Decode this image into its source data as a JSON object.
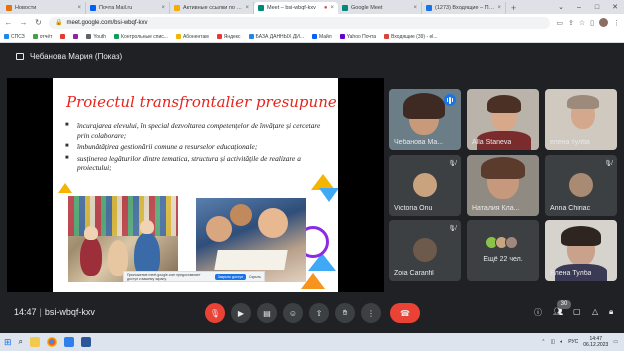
{
  "browser": {
    "tabs": [
      {
        "title": "Новости",
        "color": "#e8710a",
        "active": false
      },
      {
        "title": "Почта Mail.ru",
        "color": "#005ff9",
        "active": false
      },
      {
        "title": "Активные ссылки по сез...",
        "color": "#f9ab00",
        "active": false
      },
      {
        "title": "Meet – bsi-wbqf-kxv",
        "color": "#00897b",
        "active": true
      },
      {
        "title": "Google Meet",
        "color": "#00897b",
        "active": false
      },
      {
        "title": "(1273) Входящие – Почта",
        "color": "#1a73e8",
        "active": false
      }
    ],
    "new_tab": "+",
    "url": "meet.google.com/bsi-wbqf-kxv",
    "bookmarks": [
      {
        "label": "СПСЗ",
        "color": "#1e88e5"
      },
      {
        "label": "отчёт",
        "color": "#43a047"
      },
      {
        "label": "",
        "color": "#e53935"
      },
      {
        "label": "",
        "color": "#8e24aa"
      },
      {
        "label": "Youth",
        "color": "#5f6368"
      },
      {
        "label": "Контрольные спис...",
        "color": "#0f9d58"
      },
      {
        "label": "Абонентам",
        "color": "#f4b400"
      },
      {
        "label": "Яндекс",
        "color": "#e53935"
      },
      {
        "label": "БАЗА ДАННЫХ ДИ...",
        "color": "#1e88e5"
      },
      {
        "label": "Майл",
        "color": "#005ff9"
      },
      {
        "label": "Yahoo Почта",
        "color": "#6001d2"
      },
      {
        "label": "Входящие (39) - el...",
        "color": "#db4437"
      }
    ]
  },
  "meet": {
    "presenter": "Чебанова Мария (Показ)",
    "slide": {
      "title": "Proiectul transfrontalier presupune:",
      "bullets": [
        "încurajarea elevului, în special dezvoltarea competențelor de învățare și cercetare prin colaborare;",
        "îmbunătățirea gestionării comune a resurselor educaționale;",
        "susținerea legăturilor dintre tematica, structura și activitățile de realizare a proiectului;"
      ],
      "notif_text": "Приложение meet.google.com предоставляет доступ к вашему экрану.",
      "notif_button": "Закрыть доступ",
      "notif_hide": "Скрыть"
    },
    "participants": [
      {
        "name": "Чебанова Ма...",
        "video": true,
        "speaking": true
      },
      {
        "name": "Alla Staneva",
        "video": true,
        "speaking": false
      },
      {
        "name": "елена тулба",
        "video": true,
        "speaking": false
      },
      {
        "name": "Victoria Onu",
        "video": false,
        "avatar_color": "#c9a27e"
      },
      {
        "name": "Наталия Кла...",
        "video": true,
        "speaking": false
      },
      {
        "name": "Anna Chiriac",
        "video": false,
        "avatar_color": "#a88b72"
      },
      {
        "name": "Zoia Caranfil",
        "video": false,
        "avatar_color": "#6d5a4a"
      },
      {
        "name": "Ещё 22 чел.",
        "more": true
      },
      {
        "name": "Елена Тулба",
        "video": true,
        "speaking": false
      }
    ],
    "time": "14:47",
    "meeting_code": "bsi-wbqf-kxv",
    "participant_count": "30"
  },
  "taskbar": {
    "time": "14:47",
    "date": "06.12.2023",
    "lang": "РУС"
  },
  "colors": {
    "meet_bg": "#202124",
    "tile_bg": "#3c4043",
    "danger": "#ea4335",
    "accent": "#1a73e8",
    "slide_title": "#e8231b"
  }
}
